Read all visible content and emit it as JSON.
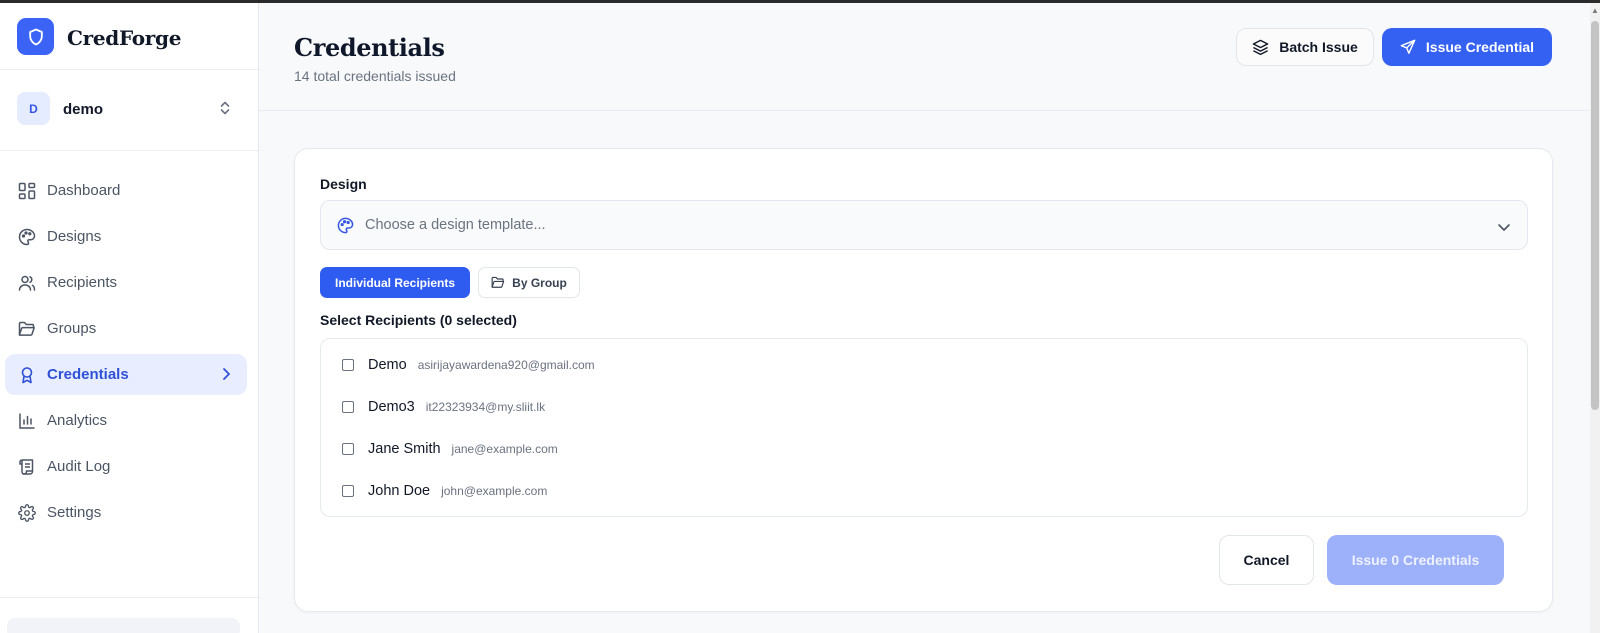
{
  "app": {
    "name": "CredForge"
  },
  "workspace": {
    "initial": "D",
    "name": "demo"
  },
  "sidebar": {
    "items": [
      {
        "label": "Dashboard",
        "icon": "dashboard-icon"
      },
      {
        "label": "Designs",
        "icon": "palette-icon"
      },
      {
        "label": "Recipients",
        "icon": "users-icon"
      },
      {
        "label": "Groups",
        "icon": "folder-icon"
      },
      {
        "label": "Credentials",
        "icon": "award-icon",
        "active": true
      },
      {
        "label": "Analytics",
        "icon": "bar-chart-icon"
      },
      {
        "label": "Audit Log",
        "icon": "scroll-icon"
      },
      {
        "label": "Settings",
        "icon": "gear-icon"
      }
    ]
  },
  "header": {
    "title": "Credentials",
    "subtitle": "14 total credentials issued",
    "batch_label": "Batch Issue",
    "issue_label": "Issue Credential"
  },
  "form": {
    "design_label": "Design",
    "design_placeholder": "Choose a design template...",
    "tabs": [
      "Individual Recipients",
      "By Group"
    ],
    "select_label": "Select Recipients (0 selected)",
    "recipients": [
      {
        "name": "Demo",
        "email": "asirijayawardena920@gmail.com"
      },
      {
        "name": "Demo3",
        "email": "it22323934@my.sliit.lk"
      },
      {
        "name": "Jane Smith",
        "email": "jane@example.com"
      },
      {
        "name": "John Doe",
        "email": "john@example.com"
      }
    ],
    "cancel_label": "Cancel",
    "submit_label": "Issue 0 Credentials"
  },
  "colors": {
    "accent": "#3561f2",
    "accent_disabled": "#9db1fb",
    "active_nav_bg": "#e8edff"
  }
}
